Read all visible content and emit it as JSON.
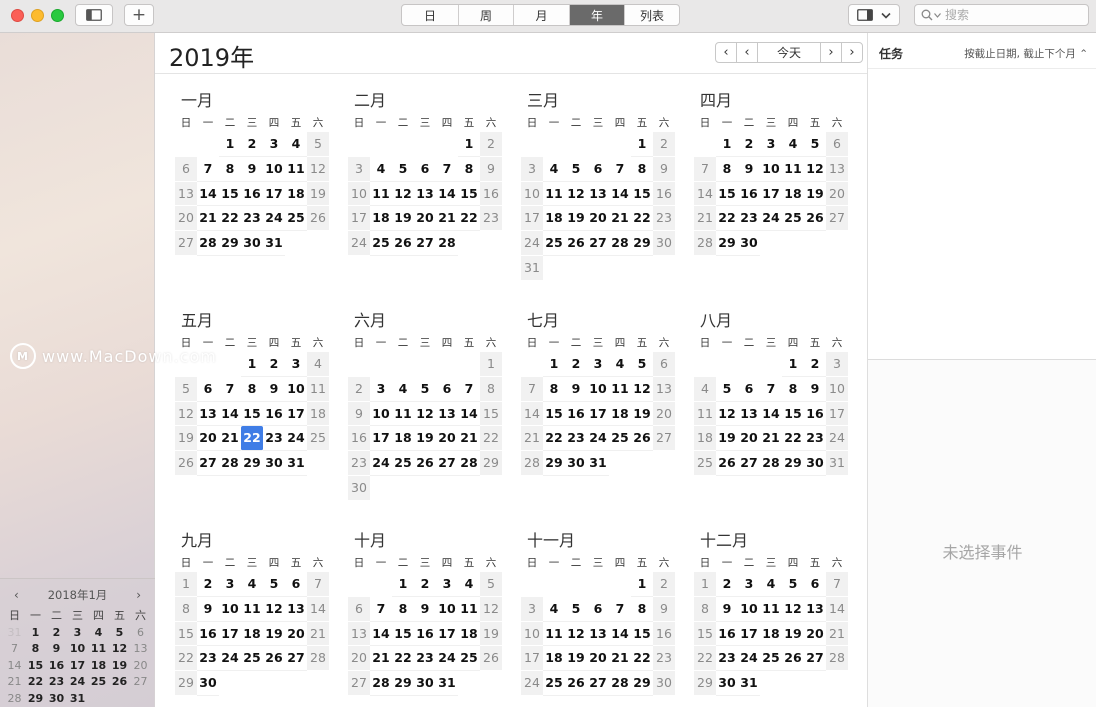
{
  "toolbar": {
    "add_label": "+",
    "views": [
      {
        "label": "日",
        "width": 57
      },
      {
        "label": "周",
        "width": 55
      },
      {
        "label": "月",
        "width": 56
      },
      {
        "label": "年",
        "width": 55,
        "active": true
      },
      {
        "label": "列表",
        "width": 54
      }
    ],
    "search_placeholder": "搜索"
  },
  "main": {
    "year_title": "2019年",
    "today_label": "今天",
    "prev_arrow": "‹",
    "next_arrow": "›",
    "weekdays": [
      "日",
      "一",
      "二",
      "三",
      "四",
      "五",
      "六"
    ],
    "months": [
      {
        "name": "一月",
        "offset": 2,
        "days": 31
      },
      {
        "name": "二月",
        "offset": 5,
        "days": 28
      },
      {
        "name": "三月",
        "offset": 5,
        "days": 31
      },
      {
        "name": "四月",
        "offset": 1,
        "days": 30
      },
      {
        "name": "五月",
        "offset": 3,
        "days": 31,
        "today": 22
      },
      {
        "name": "六月",
        "offset": 6,
        "days": 30
      },
      {
        "name": "七月",
        "offset": 1,
        "days": 31
      },
      {
        "name": "八月",
        "offset": 4,
        "days": 31
      },
      {
        "name": "九月",
        "offset": 0,
        "days": 30
      },
      {
        "name": "十月",
        "offset": 2,
        "days": 31
      },
      {
        "name": "十一月",
        "offset": 5,
        "days": 30
      },
      {
        "name": "十二月",
        "offset": 0,
        "days": 31
      }
    ]
  },
  "sidebar": {
    "watermark": "www.MacDown.com",
    "watermark_logo": "M",
    "mini_calendar": {
      "title": "2018年1月",
      "prev": "‹",
      "next": "›",
      "weekdays": [
        "日",
        "一",
        "二",
        "三",
        "四",
        "五",
        "六"
      ],
      "rows": [
        [
          "31",
          "1",
          "2",
          "3",
          "4",
          "5",
          "6"
        ],
        [
          "7",
          "8",
          "9",
          "10",
          "11",
          "12",
          "13"
        ],
        [
          "14",
          "15",
          "16",
          "17",
          "18",
          "19",
          "20"
        ],
        [
          "21",
          "22",
          "23",
          "24",
          "25",
          "26",
          "27"
        ],
        [
          "28",
          "29",
          "30",
          "31",
          "",
          "",
          ""
        ]
      ]
    }
  },
  "inspector": {
    "tasks_title": "任务",
    "sort_label": "按截止日期, 截止下个月 ⌃",
    "no_event": "未选择事件"
  }
}
